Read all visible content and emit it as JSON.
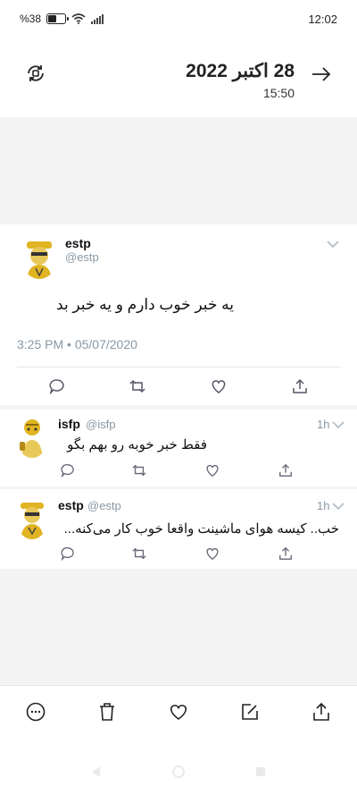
{
  "status_bar": {
    "battery": "%38",
    "time": "12:02"
  },
  "header": {
    "date": "28 اکتبر 2022",
    "time": "15:50"
  },
  "main_tweet": {
    "name": "estp",
    "handle": "@estp",
    "text": "یه خبر خوب دارم و یه خبر بد",
    "timestamp": "3:25 PM • 05/07/2020"
  },
  "replies": [
    {
      "name": "isfp",
      "handle": "@isfp",
      "time_ago": "1h",
      "text": "فقط خبر خوبه رو بهم بگو"
    },
    {
      "name": "estp",
      "handle": "@estp",
      "time_ago": "1h",
      "text": "خب.. کیسه هوای ماشینت واقعا خوب کار می‌کنه..."
    }
  ],
  "colors": {
    "muted": "#8899a6",
    "gray_bg": "#f4f4f4",
    "avatar_yellow": "#e0b422"
  },
  "icons": {
    "header": [
      "rotate-icon",
      "arrow-right-icon"
    ],
    "tweet_actions": [
      "reply-icon",
      "retweet-icon",
      "like-icon",
      "share-icon"
    ],
    "bottom_bar": [
      "more-icon",
      "delete-icon",
      "like-icon",
      "edit-icon",
      "share-icon"
    ]
  }
}
